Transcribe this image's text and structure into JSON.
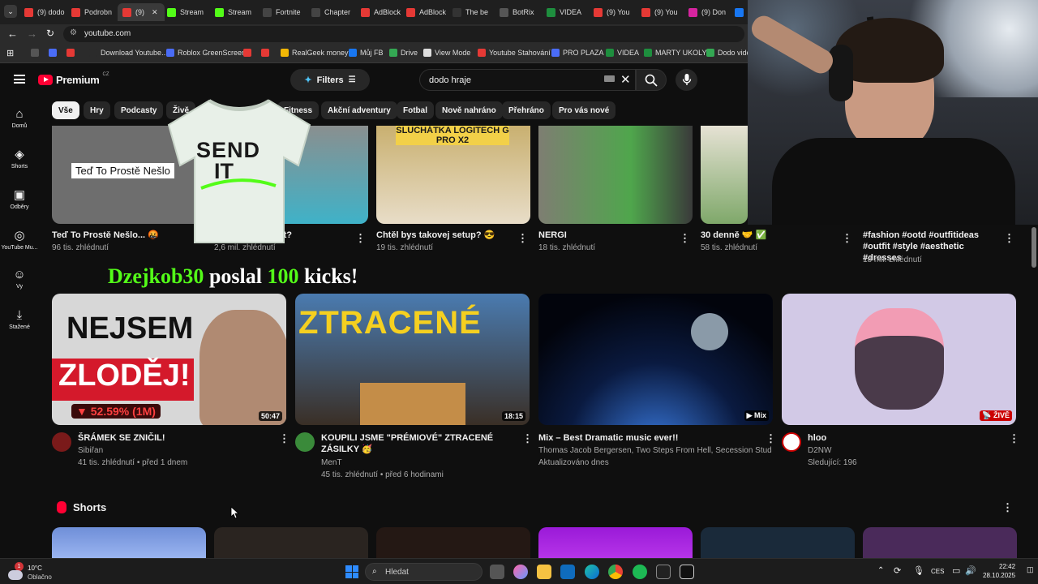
{
  "browser": {
    "tabs": [
      {
        "label": "(9) dodo",
        "color": "#e53935"
      },
      {
        "label": "Podrobn",
        "color": "#e53935"
      },
      {
        "label": "(9)",
        "color": "#e53935",
        "active": true
      },
      {
        "label": "Stream",
        "color": "#53fc18"
      },
      {
        "label": "Stream",
        "color": "#53fc18"
      },
      {
        "label": "Fortnite",
        "color": "#444"
      },
      {
        "label": "Chapter",
        "color": "#444"
      },
      {
        "label": "AdBlock",
        "color": "#e53935"
      },
      {
        "label": "AdBlock",
        "color": "#e53935"
      },
      {
        "label": "The be",
        "color": "#333"
      },
      {
        "label": "BotRix",
        "color": "#555"
      },
      {
        "label": "VIDEA",
        "color": "#1e8e3e"
      },
      {
        "label": "(9) You",
        "color": "#e53935"
      },
      {
        "label": "(9) You",
        "color": "#e53935"
      },
      {
        "label": "(9) Don",
        "color": "#d6249f"
      },
      {
        "label": "",
        "color": "#1877f2"
      }
    ],
    "url": "youtube.com",
    "bookmarks": [
      {
        "label": "",
        "color": "#555"
      },
      {
        "label": "",
        "color": "#4a6cf7"
      },
      {
        "label": "",
        "color": "#e53935"
      },
      {
        "label": "Download Youtube...",
        "color": "#2b2b2b"
      },
      {
        "label": "Roblox GreenScreen",
        "color": "#4a6cf7"
      },
      {
        "label": "",
        "color": "#e53935"
      },
      {
        "label": "",
        "color": "#e53935"
      },
      {
        "label": "RealGeek money",
        "color": "#f2b705"
      },
      {
        "label": "Můj FB",
        "color": "#1877f2"
      },
      {
        "label": "Drive",
        "color": "#34a853"
      },
      {
        "label": "View Mode",
        "color": "#ddd"
      },
      {
        "label": "Youtube Stahování",
        "color": "#e53935"
      },
      {
        "label": "PRO PLAZA",
        "color": "#4a6cf7"
      },
      {
        "label": "VIDEA",
        "color": "#1e8e3e"
      },
      {
        "label": "MARTY UKOLY",
        "color": "#1e8e3e"
      },
      {
        "label": "Dodo vide",
        "color": "#34a853"
      }
    ]
  },
  "youtube": {
    "logo_text": "Premium",
    "logo_region": "CZ",
    "filters_label": "Filters",
    "search_value": "dodo hraje",
    "chips": [
      "Vše",
      "Hry",
      "Podcasty",
      "Živě",
      "Fitness",
      "Akční adventury",
      "Fotbal",
      "Nově nahráno",
      "Přehráno",
      "Pro vás nové"
    ],
    "nav": [
      {
        "icon": "home-icon",
        "label": "Domů"
      },
      {
        "icon": "shorts-icon",
        "label": "Shorts"
      },
      {
        "icon": "subscriptions-icon",
        "label": "Odběry"
      },
      {
        "icon": "youtube-music-icon",
        "label": "YouTube Mu..."
      },
      {
        "icon": "you-icon",
        "label": "Vy"
      },
      {
        "icon": "download-icon",
        "label": "Stažené"
      }
    ],
    "row1": [
      {
        "title": "Teď To Prostě Nešlo... 🤬",
        "meta": "96 tis. zhlédnutí",
        "thumb_text": "Teď To Prostě Nešlo"
      },
      {
        "title": "...žeme spadnout?",
        "meta": "2,6 mil. zhlédnutí"
      },
      {
        "title": "Chtěl bys takovej setup? 😎",
        "meta": "19 tis. zhlédnutí",
        "thumb_text": "SLUCHÁTKA LOGITECH G PRO X2"
      },
      {
        "title": "NERGI",
        "meta": "18 tis. zhlédnutí"
      },
      {
        "title": "30 denně 🤝 ✅",
        "meta": "58 tis. zhlédnutí"
      },
      {
        "title": "#fashion #ootd #outfitideas #outfit #style #aesthetic #dresses",
        "meta": "18 mil. zhlédnutí"
      }
    ],
    "overlay": {
      "name": "Dzejkob30",
      "text1": "poslal",
      "amount": "100",
      "text2": "kicks!",
      "shirt_text1": "SEND",
      "shirt_text2": "IT"
    },
    "row2": [
      {
        "title": "ŠRÁMEK SE ZNIČIL!",
        "channel": "Sibiřan",
        "meta": "41 tis. zhlédnutí • před 1 dnem",
        "duration": "50:47",
        "thumb_text1": "NEJSEM",
        "thumb_text2": "ZLODĚJ!",
        "thumb_text3": "▼ 52.59% (1M)"
      },
      {
        "title": "KOUPILI JSME \"PRÉMIOVÉ\" ZTRACENÉ ZÁSILKY 🥳",
        "channel": "MenT",
        "meta": "45 tis. zhlédnutí • před 6 hodinami",
        "duration": "18:15",
        "thumb_text1": "ZTRACENÉ"
      },
      {
        "title": "Mix – Best Dramatic music ever!!",
        "channel": "Thomas Jacob Bergersen, Two Steps From Hell, Secession Studios ...",
        "meta": "Aktualizováno dnes",
        "duration": "▶ Mix"
      },
      {
        "title": "hloo",
        "channel": "D2NW",
        "meta": "Sledující: 196",
        "duration": "📡 ŽIVĚ"
      }
    ],
    "shorts_label": "Shorts"
  },
  "taskbar": {
    "weather_temp": "10°C",
    "weather_desc": "Oblačno",
    "search_placeholder": "Hledat",
    "lang": "CES",
    "time": "22:42",
    "date": "28.10.2025",
    "notification_count": "1"
  },
  "colors": {
    "accent_red": "#ff0033",
    "bg": "#0f0f0f",
    "chip": "#272727",
    "kick_green": "#53fc18"
  }
}
